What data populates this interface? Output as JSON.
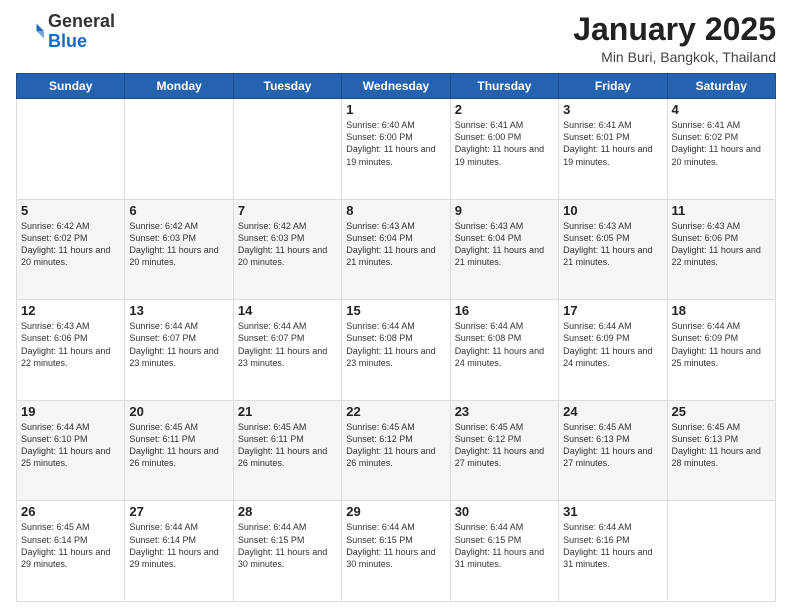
{
  "header": {
    "logo_general": "General",
    "logo_blue": "Blue",
    "month_title": "January 2025",
    "location": "Min Buri, Bangkok, Thailand"
  },
  "weekdays": [
    "Sunday",
    "Monday",
    "Tuesday",
    "Wednesday",
    "Thursday",
    "Friday",
    "Saturday"
  ],
  "weeks": [
    [
      {
        "num": "",
        "info": ""
      },
      {
        "num": "",
        "info": ""
      },
      {
        "num": "",
        "info": ""
      },
      {
        "num": "1",
        "info": "Sunrise: 6:40 AM\nSunset: 6:00 PM\nDaylight: 11 hours and 19 minutes."
      },
      {
        "num": "2",
        "info": "Sunrise: 6:41 AM\nSunset: 6:00 PM\nDaylight: 11 hours and 19 minutes."
      },
      {
        "num": "3",
        "info": "Sunrise: 6:41 AM\nSunset: 6:01 PM\nDaylight: 11 hours and 19 minutes."
      },
      {
        "num": "4",
        "info": "Sunrise: 6:41 AM\nSunset: 6:02 PM\nDaylight: 11 hours and 20 minutes."
      }
    ],
    [
      {
        "num": "5",
        "info": "Sunrise: 6:42 AM\nSunset: 6:02 PM\nDaylight: 11 hours and 20 minutes."
      },
      {
        "num": "6",
        "info": "Sunrise: 6:42 AM\nSunset: 6:03 PM\nDaylight: 11 hours and 20 minutes."
      },
      {
        "num": "7",
        "info": "Sunrise: 6:42 AM\nSunset: 6:03 PM\nDaylight: 11 hours and 20 minutes."
      },
      {
        "num": "8",
        "info": "Sunrise: 6:43 AM\nSunset: 6:04 PM\nDaylight: 11 hours and 21 minutes."
      },
      {
        "num": "9",
        "info": "Sunrise: 6:43 AM\nSunset: 6:04 PM\nDaylight: 11 hours and 21 minutes."
      },
      {
        "num": "10",
        "info": "Sunrise: 6:43 AM\nSunset: 6:05 PM\nDaylight: 11 hours and 21 minutes."
      },
      {
        "num": "11",
        "info": "Sunrise: 6:43 AM\nSunset: 6:06 PM\nDaylight: 11 hours and 22 minutes."
      }
    ],
    [
      {
        "num": "12",
        "info": "Sunrise: 6:43 AM\nSunset: 6:06 PM\nDaylight: 11 hours and 22 minutes."
      },
      {
        "num": "13",
        "info": "Sunrise: 6:44 AM\nSunset: 6:07 PM\nDaylight: 11 hours and 23 minutes."
      },
      {
        "num": "14",
        "info": "Sunrise: 6:44 AM\nSunset: 6:07 PM\nDaylight: 11 hours and 23 minutes."
      },
      {
        "num": "15",
        "info": "Sunrise: 6:44 AM\nSunset: 6:08 PM\nDaylight: 11 hours and 23 minutes."
      },
      {
        "num": "16",
        "info": "Sunrise: 6:44 AM\nSunset: 6:08 PM\nDaylight: 11 hours and 24 minutes."
      },
      {
        "num": "17",
        "info": "Sunrise: 6:44 AM\nSunset: 6:09 PM\nDaylight: 11 hours and 24 minutes."
      },
      {
        "num": "18",
        "info": "Sunrise: 6:44 AM\nSunset: 6:09 PM\nDaylight: 11 hours and 25 minutes."
      }
    ],
    [
      {
        "num": "19",
        "info": "Sunrise: 6:44 AM\nSunset: 6:10 PM\nDaylight: 11 hours and 25 minutes."
      },
      {
        "num": "20",
        "info": "Sunrise: 6:45 AM\nSunset: 6:11 PM\nDaylight: 11 hours and 26 minutes."
      },
      {
        "num": "21",
        "info": "Sunrise: 6:45 AM\nSunset: 6:11 PM\nDaylight: 11 hours and 26 minutes."
      },
      {
        "num": "22",
        "info": "Sunrise: 6:45 AM\nSunset: 6:12 PM\nDaylight: 11 hours and 26 minutes."
      },
      {
        "num": "23",
        "info": "Sunrise: 6:45 AM\nSunset: 6:12 PM\nDaylight: 11 hours and 27 minutes."
      },
      {
        "num": "24",
        "info": "Sunrise: 6:45 AM\nSunset: 6:13 PM\nDaylight: 11 hours and 27 minutes."
      },
      {
        "num": "25",
        "info": "Sunrise: 6:45 AM\nSunset: 6:13 PM\nDaylight: 11 hours and 28 minutes."
      }
    ],
    [
      {
        "num": "26",
        "info": "Sunrise: 6:45 AM\nSunset: 6:14 PM\nDaylight: 11 hours and 29 minutes."
      },
      {
        "num": "27",
        "info": "Sunrise: 6:44 AM\nSunset: 6:14 PM\nDaylight: 11 hours and 29 minutes."
      },
      {
        "num": "28",
        "info": "Sunrise: 6:44 AM\nSunset: 6:15 PM\nDaylight: 11 hours and 30 minutes."
      },
      {
        "num": "29",
        "info": "Sunrise: 6:44 AM\nSunset: 6:15 PM\nDaylight: 11 hours and 30 minutes."
      },
      {
        "num": "30",
        "info": "Sunrise: 6:44 AM\nSunset: 6:15 PM\nDaylight: 11 hours and 31 minutes."
      },
      {
        "num": "31",
        "info": "Sunrise: 6:44 AM\nSunset: 6:16 PM\nDaylight: 11 hours and 31 minutes."
      },
      {
        "num": "",
        "info": ""
      }
    ]
  ]
}
